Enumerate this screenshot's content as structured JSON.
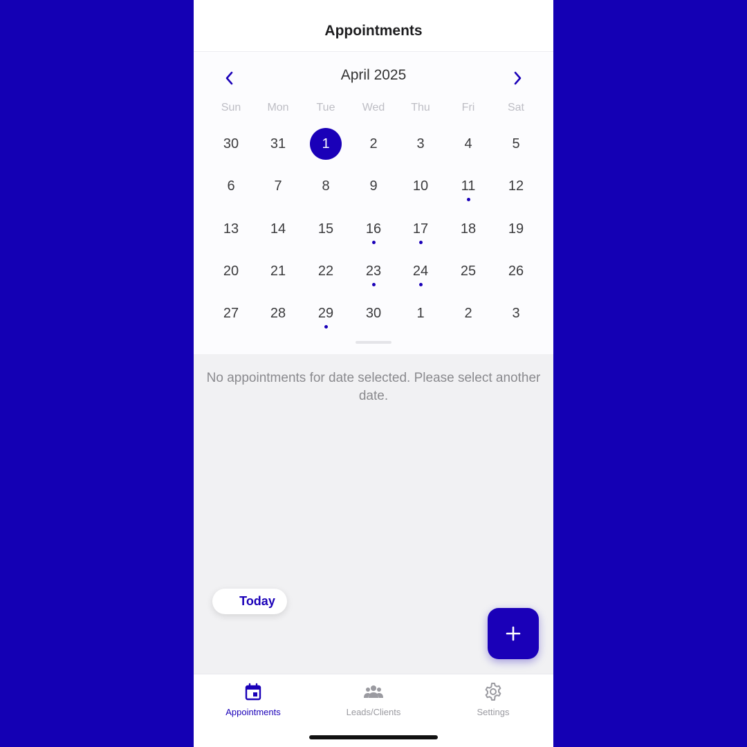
{
  "header": {
    "title": "Appointments"
  },
  "calendar": {
    "month_label": "April 2025",
    "weekdays": [
      "Sun",
      "Mon",
      "Tue",
      "Wed",
      "Thu",
      "Fri",
      "Sat"
    ],
    "weeks": [
      [
        "30",
        "31",
        "1",
        "2",
        "3",
        "4",
        "5"
      ],
      [
        "6",
        "7",
        "8",
        "9",
        "10",
        "11",
        "12"
      ],
      [
        "13",
        "14",
        "15",
        "16",
        "17",
        "18",
        "19"
      ],
      [
        "20",
        "21",
        "22",
        "23",
        "24",
        "25",
        "26"
      ],
      [
        "27",
        "28",
        "29",
        "30",
        "1",
        "2",
        "3"
      ]
    ],
    "selected_day": "1",
    "days_with_appointments": [
      "11",
      "16",
      "17",
      "23",
      "24",
      "29"
    ]
  },
  "empty_state": {
    "message": "No appointments for date selected. Please select another date."
  },
  "today_button": {
    "label": "Today"
  },
  "fab": {
    "icon": "plus-icon"
  },
  "tabbar": {
    "items": [
      {
        "label": "Appointments",
        "icon": "calendar-icon",
        "active": true
      },
      {
        "label": "Leads/Clients",
        "icon": "people-icon",
        "active": false
      },
      {
        "label": "Settings",
        "icon": "gear-icon",
        "active": false
      }
    ]
  },
  "colors": {
    "accent": "#1a00b8",
    "background": "#1400b4"
  }
}
